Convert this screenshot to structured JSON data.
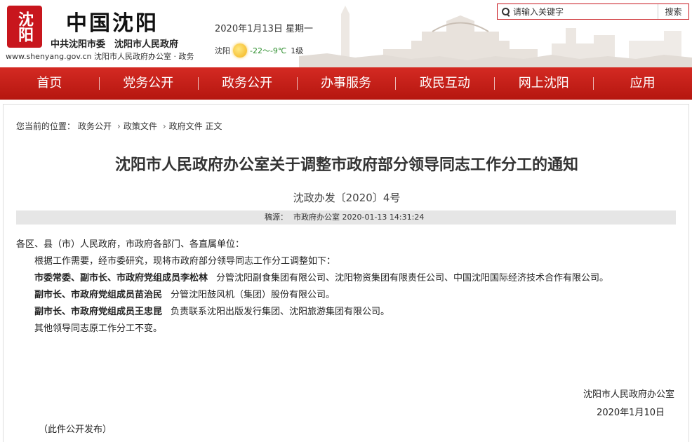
{
  "header": {
    "logo_seal_text": "沈阳",
    "site_title": "中国沈阳",
    "subtitle": "中共沈阳市委　沈阳市人民政府",
    "url_line": "www.shenyang.gov.cn 沈阳市人民政府办公室 · 政务",
    "date": "2020年1月13日 星期一",
    "weather": {
      "city": "沈阳",
      "icon": "sun-icon",
      "temperature": "-22～-9℃",
      "wind": "1级"
    },
    "search": {
      "placeholder": "请输入关键字",
      "button_label": "搜索"
    }
  },
  "nav": {
    "items": [
      "首页",
      "党务公开",
      "政务公开",
      "办事服务",
      "政民互动",
      "网上沈阳",
      "应用"
    ]
  },
  "breadcrumb": {
    "prefix": "您当前的位置：",
    "items": [
      "政务公开",
      "政策文件",
      "政府文件 正文"
    ]
  },
  "document": {
    "title": "沈阳市人民政府办公室关于调整市政府部分领导同志工作分工的通知",
    "number": "沈政办发〔2020〕4号",
    "source_label": "稿源：",
    "source": "市政府办公室",
    "published": "2020-01-13 14:31:24",
    "salutation": "各区、县（市）人民政府，市政府各部门、各直属单位：",
    "intro": "根据工作需要，经市委研究，现将市政府部分领导同志工作分工调整如下：",
    "assignments": [
      {
        "person": "市委常委、副市长、市政府党组成员李松林",
        "duty": "分管沈阳副食集团有限公司、沈阳物资集团有限责任公司、中国沈阳国际经济技术合作有限公司。"
      },
      {
        "person": "副市长、市政府党组成员苗治民",
        "duty": "分管沈阳鼓风机（集团）股份有限公司。"
      },
      {
        "person": "副市长、市政府党组成员王忠昆",
        "duty": "负责联系沈阳出版发行集团、沈阳旅游集团有限公司。"
      }
    ],
    "closing": "其他领导同志原工作分工不变。",
    "sign_org": "沈阳市人民政府办公室",
    "sign_date": "2020年1月10日",
    "footnote": "（此件公开发布）"
  },
  "colors": {
    "brand_red": "#c8161d",
    "nav_red": "#c21d16",
    "source_bar": "#e6e6e6"
  }
}
